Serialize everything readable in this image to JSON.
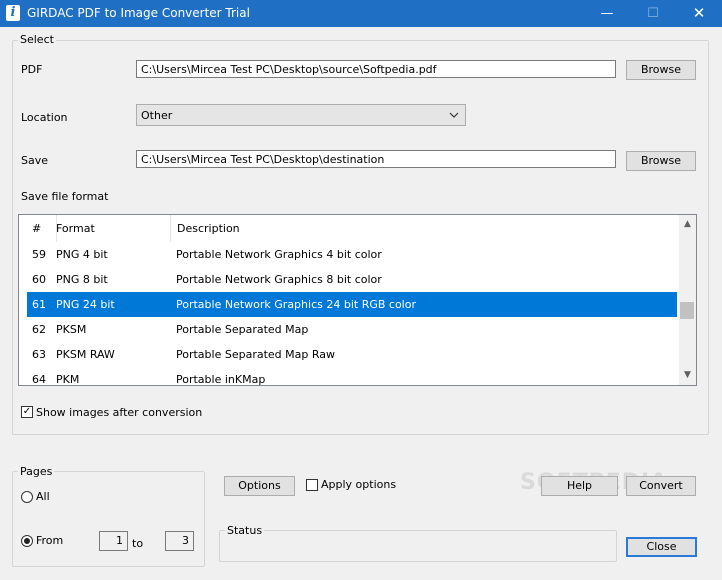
{
  "window": {
    "title": "GIRDAC PDF to Image Converter Trial",
    "icon_glyph": "i",
    "min_glyph": "—",
    "max_glyph": "☐",
    "close_glyph": "✕"
  },
  "select_group": {
    "title": "Select",
    "pdf_label": "PDF",
    "pdf_value": "C:\\Users\\Mircea Test PC\\Desktop\\source\\Softpedia.pdf",
    "browse1": "Browse",
    "location_label": "Location",
    "location_value": "Other",
    "save_label": "Save",
    "save_value": "C:\\Users\\Mircea Test PC\\Desktop\\destination",
    "browse2": "Browse",
    "format_label": "Save file format",
    "columns": [
      "#",
      "Format",
      "Description"
    ],
    "rows": [
      {
        "num": "59",
        "format": "PNG 4 bit",
        "desc": "Portable Network Graphics 4 bit color",
        "selected": false
      },
      {
        "num": "60",
        "format": "PNG 8 bit",
        "desc": "Portable Network Graphics 8 bit color",
        "selected": false
      },
      {
        "num": "61",
        "format": "PNG 24 bit",
        "desc": "Portable Network Graphics 24 bit RGB color",
        "selected": true
      },
      {
        "num": "62",
        "format": "PKSM",
        "desc": "Portable Separated Map",
        "selected": false
      },
      {
        "num": "63",
        "format": "PKSM RAW",
        "desc": "Portable Separated Map Raw",
        "selected": false
      },
      {
        "num": "64",
        "format": "PKM",
        "desc": "Portable inKMap",
        "selected": false
      }
    ],
    "show_images_label": "Show images after conversion",
    "show_images_checked": true
  },
  "pages_group": {
    "title": "Pages",
    "all_label": "All",
    "from_label": "From",
    "from_value": "1",
    "to_label": "to",
    "to_value": "3",
    "selected": "From"
  },
  "actions": {
    "options": "Options",
    "apply_options": "Apply options",
    "help": "Help",
    "convert": "Convert",
    "close": "Close"
  },
  "status_group": {
    "title": "Status"
  },
  "watermark": "SOFTPEDIA",
  "colors": {
    "titlebar": "#1f6fc5",
    "selection": "#0078d7",
    "focus": "#2a7ad8"
  }
}
